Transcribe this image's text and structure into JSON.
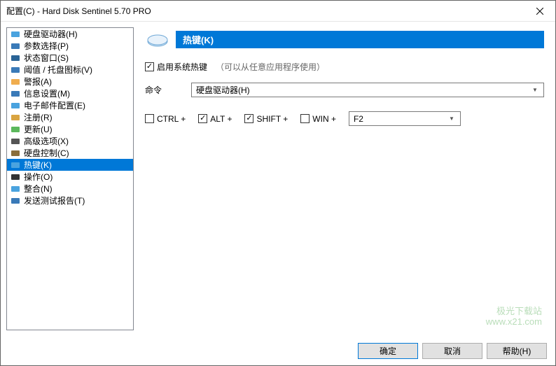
{
  "window": {
    "title": "配置(C)  -  Hard Disk Sentinel 5.70 PRO"
  },
  "sidebar": {
    "items": [
      {
        "label": "硬盘驱动器(H)",
        "iconColor": "#4aa3df"
      },
      {
        "label": "参数选择(P)",
        "iconColor": "#3a7ab8"
      },
      {
        "label": "状态窗口(S)",
        "iconColor": "#2a6496"
      },
      {
        "label": "阈值 / 托盘图标(V)",
        "iconColor": "#3a7ab8"
      },
      {
        "label": "警报(A)",
        "iconColor": "#f0ad4e"
      },
      {
        "label": "信息设置(M)",
        "iconColor": "#3a7ab8"
      },
      {
        "label": "电子邮件配置(E)",
        "iconColor": "#4aa3df"
      },
      {
        "label": "注册(R)",
        "iconColor": "#d9a441"
      },
      {
        "label": "更新(U)",
        "iconColor": "#5cb85c"
      },
      {
        "label": "高级选项(X)",
        "iconColor": "#555555"
      },
      {
        "label": "硬盘控制(C)",
        "iconColor": "#8a6d3b"
      },
      {
        "label": "热键(K)",
        "iconColor": "#4aa3df",
        "selected": true
      },
      {
        "label": "操作(O)",
        "iconColor": "#333333"
      },
      {
        "label": "整合(N)",
        "iconColor": "#4aa3df"
      },
      {
        "label": "发送测试报告(T)",
        "iconColor": "#3a7ab8"
      }
    ]
  },
  "main": {
    "headerTitle": "热键(K)",
    "enableLabel": "启用系统热键",
    "enableNote": "（可以从任意应用程序使用）",
    "commandLabel": "命令",
    "commandValue": "硬盘驱动器(H)",
    "modifiers": {
      "ctrl": {
        "label": "CTRL +",
        "checked": false
      },
      "alt": {
        "label": "ALT +",
        "checked": true
      },
      "shift": {
        "label": "SHIFT +",
        "checked": true
      },
      "win": {
        "label": "WIN +",
        "checked": false
      }
    },
    "keyValue": "F2"
  },
  "footer": {
    "ok": "确定",
    "cancel": "取消",
    "help": "帮助(H)"
  },
  "watermark": {
    "line1": "极光下载站",
    "line2": "www.x21.com"
  }
}
